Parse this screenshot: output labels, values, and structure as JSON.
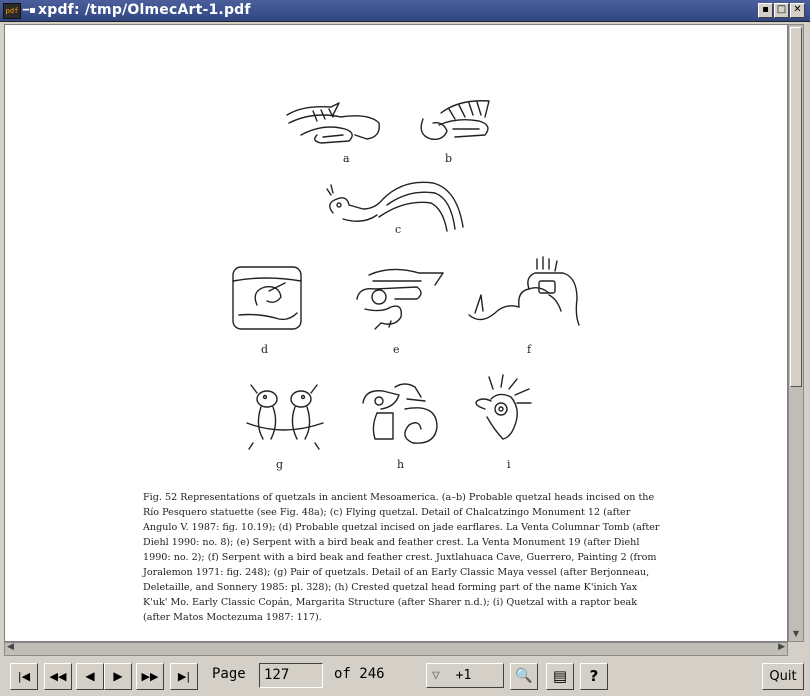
{
  "window": {
    "title": "xpdf: /tmp/OlmecArt-1.pdf",
    "app_icon_text": "pdf",
    "menu_glyph": "━▪",
    "buttons": {
      "iconify": "▪",
      "maximize": "□",
      "close": "✕"
    }
  },
  "document": {
    "figure_letters": [
      "a",
      "b",
      "c",
      "d",
      "e",
      "f",
      "g",
      "h",
      "i"
    ],
    "caption": "Fig. 52  Representations of quetzals in ancient Mesoamerica. (a–b) Probable quetzal heads incised on the Río Pesquero statuette (see Fig. 48a); (c) Flying quetzal. Detail of Chalcatzingo Monument 12 (after Angulo V. 1987: fig. 10.19); (d) Probable quetzal incised on jade earflares. La Venta Columnar Tomb (after Diehl 1990: no. 8); (e) Serpent with a bird beak and feather crest. La Venta Monument 19 (after Diehl 1990: no. 2); (f) Serpent with a bird beak and feather crest. Juxtlahuaca Cave, Guerrero, Painting 2 (from Joralemon 1971: fig. 248); (g) Pair of quetzals. Detail of an Early Classic Maya vessel (after Berjonneau, Deletaille, and Sonnery 1985: pl. 328); (h) Crested quetzal head forming part of the name K'inich Yax K'uk' Mo. Early Classic Copán, Margarita Structure (after Sharer n.d.); (i) Quetzal with a raptor beak (after Matos Moctezuma 1987: 117)."
  },
  "toolbar": {
    "first_page": "|◀",
    "back10": "◀◀",
    "prev": "◀",
    "next": "▶",
    "fwd10": "▶▶",
    "last_page": "▶|",
    "page_label": "Page",
    "page_value": "127",
    "of_label": "of 246",
    "zoom_arrow": "▽",
    "zoom_value": "+1",
    "find_icon": "🔍",
    "print_icon": "▤",
    "help": "?",
    "quit": "Quit"
  },
  "scrollbars": {
    "up": "▲",
    "down": "▼",
    "left": "◀",
    "right": "▶"
  }
}
